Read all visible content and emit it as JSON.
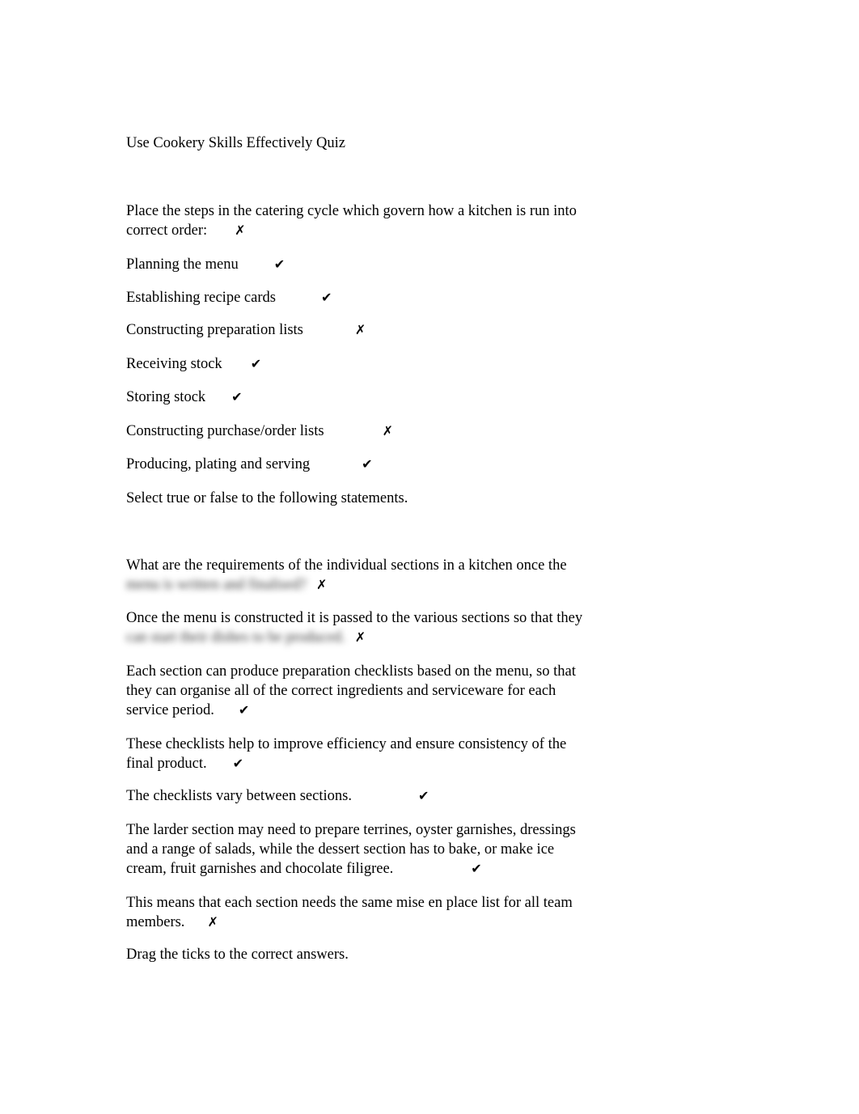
{
  "title": "Use Cookery Skills Effectively Quiz",
  "icons": {
    "tick": "✔",
    "cross": "✗"
  },
  "q1": {
    "prompt_line1": "Place the steps in the catering cycle which govern how a kitchen is run into",
    "prompt_line2": "correct order:",
    "prompt_mark": "✗",
    "items": [
      {
        "label": "Planning the menu",
        "mark": "✔"
      },
      {
        "label": "Establishing recipe cards",
        "mark": "✔"
      },
      {
        "label": "Constructing preparation lists",
        "mark": "✗"
      },
      {
        "label": "Receiving stock",
        "mark": "✔"
      },
      {
        "label": "Storing stock",
        "mark": "✔"
      },
      {
        "label": "Constructing purchase/order lists",
        "mark": "✗"
      },
      {
        "label": "Producing, plating and serving",
        "mark": "✔"
      }
    ]
  },
  "q2": {
    "instruction": "Select true or false to the following statements.",
    "statements": [
      {
        "line1": "What are the requirements of the individual sections in a kitchen once the",
        "line2_blurred": "menu is written and finalised?",
        "mark": "✗"
      },
      {
        "line1": "Once the menu is constructed it is passed to the various sections so that they",
        "line2_blurred": "can start their dishes to be produced.",
        "mark": "✗"
      },
      {
        "lines": [
          "Each section can produce preparation checklists based on the menu, so that",
          "they can organise all of the correct ingredients and serviceware for each",
          "service period."
        ],
        "mark": "✔"
      },
      {
        "lines": [
          "These checklists help to improve efficiency and ensure consistency of the",
          "final product."
        ],
        "mark": "✔"
      },
      {
        "lines": [
          "The checklists vary between sections."
        ],
        "mark": "✔"
      },
      {
        "lines": [
          "The larder section may need to prepare terrines, oyster garnishes, dressings",
          "and a range of salads, while the dessert section has to bake, or make ice",
          "cream, fruit garnishes and chocolate filigree."
        ],
        "mark": "✔"
      },
      {
        "lines": [
          "This means that each section needs the same mise en place list for all team",
          "members."
        ],
        "mark": "✗"
      }
    ]
  },
  "q3": {
    "instruction": "Drag the ticks to the correct answers."
  }
}
